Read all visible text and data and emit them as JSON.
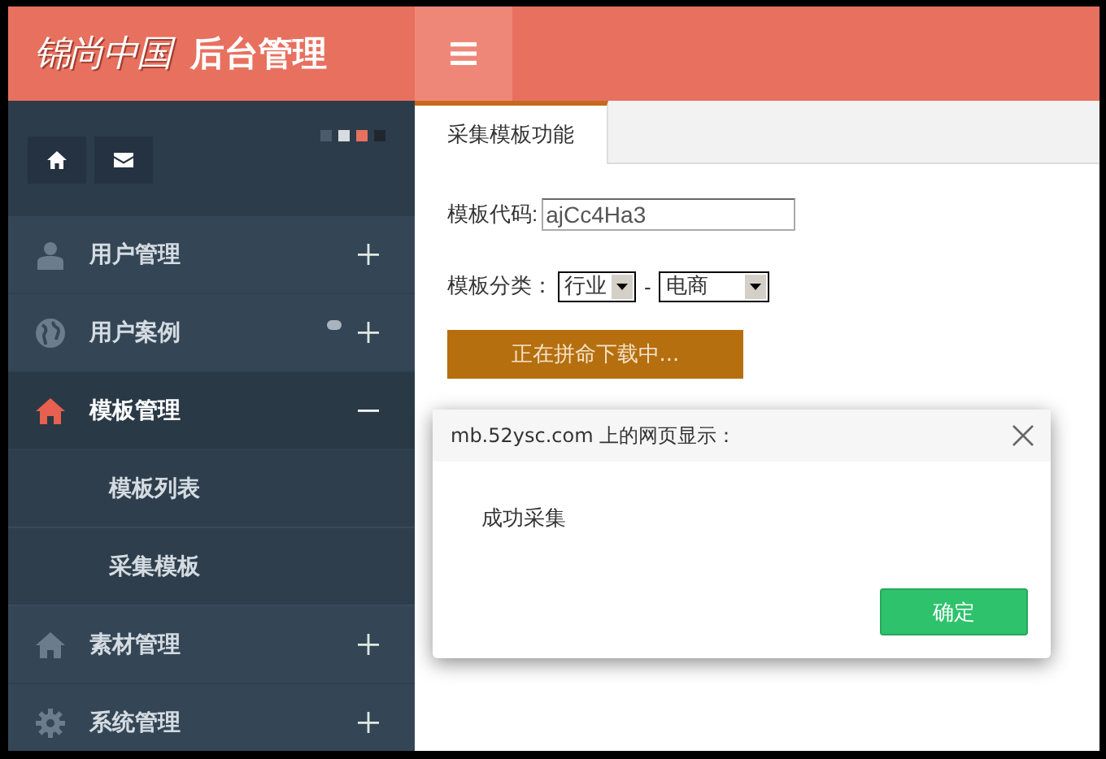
{
  "header": {
    "logo": "锦尚中国",
    "title": "后台管理"
  },
  "sidebar": {
    "swatches": [
      {
        "color": "#4b5b6d"
      },
      {
        "color": "#d8dce0"
      },
      {
        "color": "#e8705f"
      },
      {
        "color": "#1f262d"
      }
    ],
    "items": [
      {
        "label": "用户管理",
        "kind": "user",
        "notification": false,
        "expanded": false,
        "selected": false
      },
      {
        "label": "用户案例",
        "kind": "globe",
        "notification": true,
        "expanded": false,
        "selected": false
      },
      {
        "label": "模板管理",
        "kind": "home",
        "notification": false,
        "expanded": true,
        "selected": true,
        "children": [
          {
            "label": "模板列表"
          },
          {
            "label": "采集模板"
          }
        ]
      },
      {
        "label": "素材管理",
        "kind": "home",
        "notification": false,
        "expanded": false,
        "selected": false
      },
      {
        "label": "系统管理",
        "kind": "gear",
        "notification": false,
        "expanded": false,
        "selected": false
      }
    ]
  },
  "tabs": [
    {
      "label": "采集模板功能",
      "selected": true
    }
  ],
  "form": {
    "code_label": "模板代码:",
    "code_value": "ajCc4Ha3",
    "category_label": "模板分类：",
    "category_values": [
      "行业",
      "电商"
    ],
    "separator": "-",
    "download_button": "正在拼命下载中..."
  },
  "dialog": {
    "title": "mb.52ysc.com 上的网页显示：",
    "message": "成功采集",
    "ok_button": "确定"
  }
}
